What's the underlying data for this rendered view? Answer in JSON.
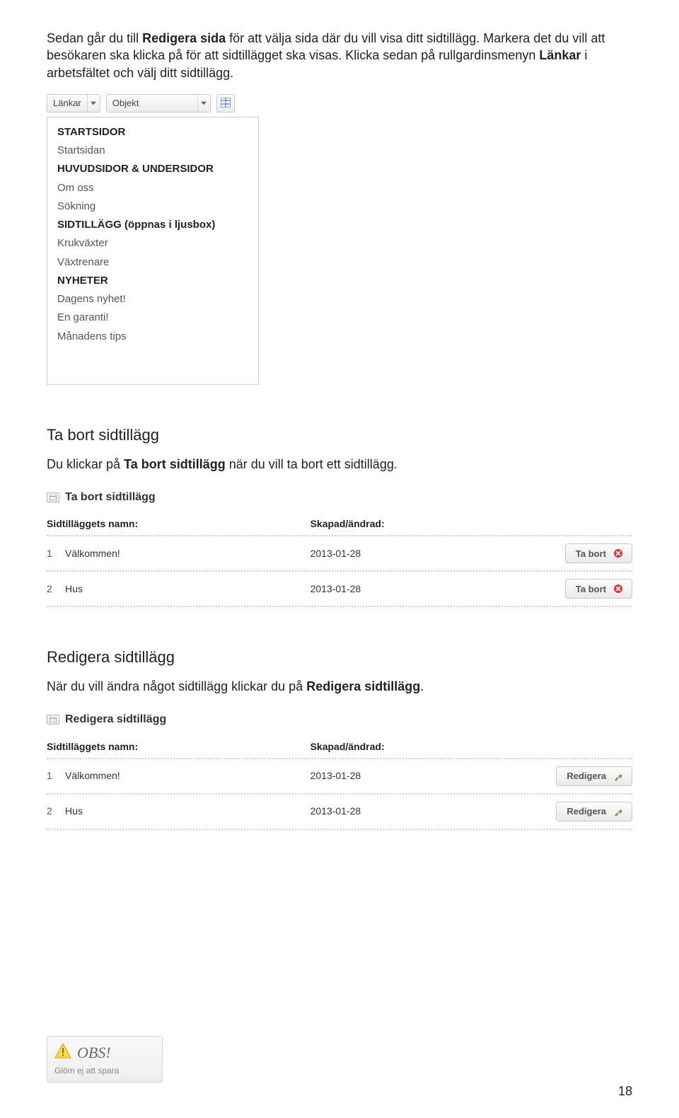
{
  "intro": {
    "part1": "Sedan går du till ",
    "bold1": "Redigera sida",
    "part2": " för att välja sida där du vill visa ditt sidtillägg. Markera det du vill att besökaren ska klicka på för att sidtillägget ska visas. Klicka sedan på rullgardinsmenyn ",
    "bold2": "Länkar",
    "part3": " i arbetsfältet och välj ditt sidtillägg."
  },
  "toolbar": {
    "links_label": "Länkar",
    "object_label": "Objekt"
  },
  "links_menu": {
    "groups": [
      {
        "head": "STARTSIDOR",
        "items": [
          "Startsidan"
        ]
      },
      {
        "head": "HUVUDSIDOR & UNDERSIDOR",
        "items": [
          "Om oss",
          "Sökning"
        ]
      },
      {
        "head": "SIDTILLÄGG (öppnas i ljusbox)",
        "items": [
          "Krukväxter",
          "Växtrenare"
        ]
      },
      {
        "head": "NYHETER",
        "items": [
          "Dagens nyhet!",
          "En garanti!",
          "Månadens tips"
        ]
      }
    ]
  },
  "delete": {
    "heading": "Ta bort sidtillägg",
    "desc_part1": "Du klickar på ",
    "desc_bold": "Ta bort sidtillägg",
    "desc_part2": " när du vill ta bort ett sidtillägg.",
    "panel_title": "Ta bort sidtillägg",
    "col_name": "Sidtilläggets namn:",
    "col_date": "Skapad/ändrad:",
    "rows": [
      {
        "idx": "1",
        "name": "Välkommen!",
        "date": "2013-01-28"
      },
      {
        "idx": "2",
        "name": "Hus",
        "date": "2013-01-28"
      }
    ],
    "btn_label": "Ta bort"
  },
  "edit": {
    "heading": "Redigera sidtillägg",
    "desc_part1": "När du vill ändra något sidtillägg klickar du på ",
    "desc_bold": "Redigera sidtillägg",
    "desc_part2": ".",
    "panel_title": "Redigera sidtillägg",
    "col_name": "Sidtilläggets namn:",
    "col_date": "Skapad/ändrad:",
    "rows": [
      {
        "idx": "1",
        "name": "Välkommen!",
        "date": "2013-01-28"
      },
      {
        "idx": "2",
        "name": "Hus",
        "date": "2013-01-28"
      }
    ],
    "btn_label": "Redigera"
  },
  "obs": {
    "title": "OBS!",
    "sub": "Glöm ej att spara"
  },
  "page_number": "18"
}
